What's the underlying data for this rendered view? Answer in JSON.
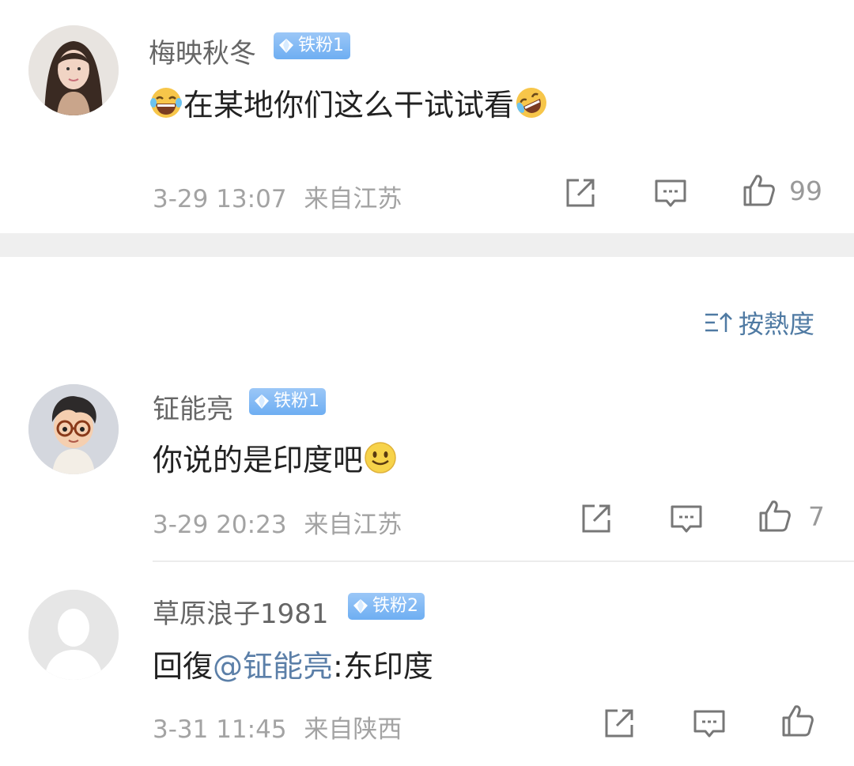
{
  "comments": [
    {
      "username": "梅映秋冬",
      "badge": "铁粉1",
      "text": "在某地你们这么干试试看",
      "time": "3-29 13:07",
      "location": "来自江苏",
      "likes": "99",
      "avatar": "woman-photo-avatar",
      "emoji_before": "laugh-cry-emoji",
      "emoji_after": "crying-laugh-emoji"
    },
    {
      "username": "钲能亮",
      "badge": "铁粉1",
      "text": "你说的是印度吧",
      "time": "3-29 20:23",
      "location": "来自江苏",
      "likes": "7",
      "avatar": "cartoon-boy-avatar",
      "emoji_after": "smile-emoji"
    },
    {
      "username": "草原浪子1981",
      "badge": "铁粉2",
      "reply_prefix": "回復",
      "mention": "@钲能亮",
      "text": ":东印度",
      "time": "3-31 11:45",
      "location": "来自陕西",
      "likes": "",
      "avatar": "default-avatar"
    }
  ],
  "sort": {
    "label": "按熱度",
    "icon": "sort-icon"
  },
  "colors": {
    "badge": "#7ab4f4",
    "mention": "#5b7fa8",
    "meta": "#a3a3a3",
    "sort": "#4f7aa3"
  }
}
